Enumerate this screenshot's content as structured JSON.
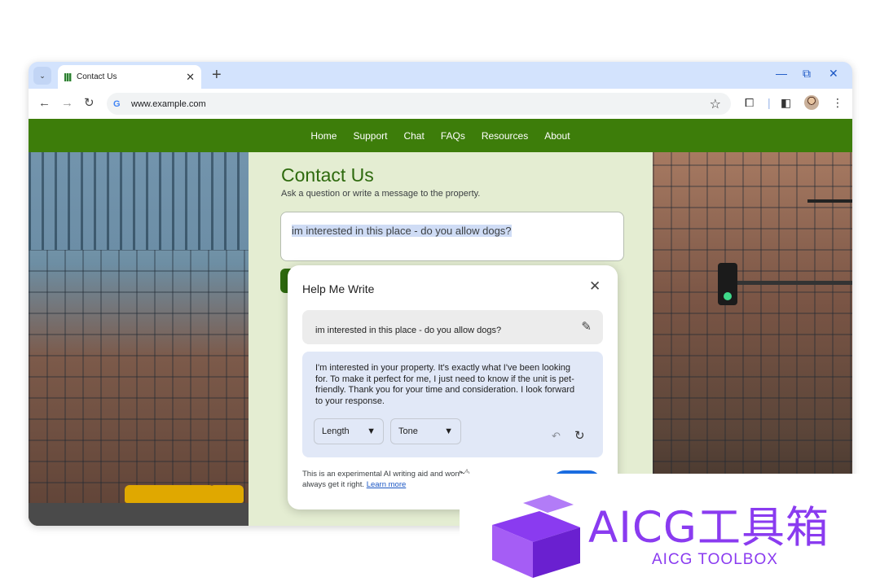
{
  "browser": {
    "tab_title": "Contact Us",
    "url": "www.example.com"
  },
  "site": {
    "nav": [
      "Home",
      "Support",
      "Chat",
      "FAQs",
      "Resources",
      "About"
    ],
    "title": "Contact Us",
    "subtitle": "Ask a question or write a message to the property.",
    "message_value": "im interested in this place - do you allow dogs?"
  },
  "help_me_write": {
    "title": "Help Me Write",
    "prompt": "im interested in this place - do you allow dogs?",
    "draft": "I'm interested in your property. It's exactly what I've been looking for. To make it perfect for me, I just need to know if the unit is pet-friendly. Thank you for your time and consideration. I look forward to your response.",
    "length_label": "Length",
    "tone_label": "Tone",
    "disclaimer": "This is an experimental AI writing aid and won't always get it right.",
    "learn_more": "Learn more"
  },
  "watermark": {
    "title": "AICG工具箱",
    "subtitle": "AICG TOOLBOX",
    "color": "#8a3bf0"
  },
  "icons": [
    "chevron-down-icon",
    "close-icon",
    "plus-icon",
    "minimize-icon",
    "restore-icon",
    "back-icon",
    "forward-icon",
    "reload-icon",
    "google-icon",
    "star-icon",
    "extensions-icon",
    "side-panel-icon",
    "menu-icon",
    "edit-icon",
    "undo-icon",
    "redo-icon",
    "thumbs-up-icon",
    "thumbs-down-icon"
  ],
  "colors": {
    "site_green": "#3d7d0a",
    "title_green": "#2e6a0e",
    "page_bg": "#e4edd2",
    "draft_bg": "#e1e8f7",
    "primary_blue": "#1a6ce0"
  }
}
